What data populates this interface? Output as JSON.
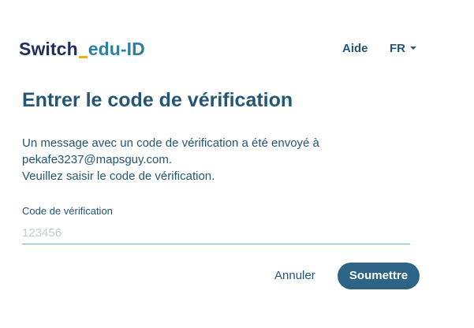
{
  "header": {
    "logo_switch": "Switch",
    "logo_edu": "edu-ID",
    "help_label": "Aide",
    "language": "FR"
  },
  "main": {
    "title": "Entrer le code de vérification",
    "message_line1": "Un message avec un code de vérification a été envoyé à",
    "message_email": "pekafe3237@mapsguy.com.",
    "message_line3": "Veuillez saisir le code de vérification.",
    "field_label": "Code de vérification",
    "field_placeholder": "123456",
    "field_value": ""
  },
  "actions": {
    "cancel_label": "Annuler",
    "submit_label": "Soumettre"
  },
  "colors": {
    "primary": "#245675",
    "button_bg": "#2d6486",
    "logo_dark": "#1e2e5e",
    "logo_accent": "#f4a91a",
    "logo_blue": "#2e7fa3",
    "input_underline": "#6cb4d6"
  }
}
